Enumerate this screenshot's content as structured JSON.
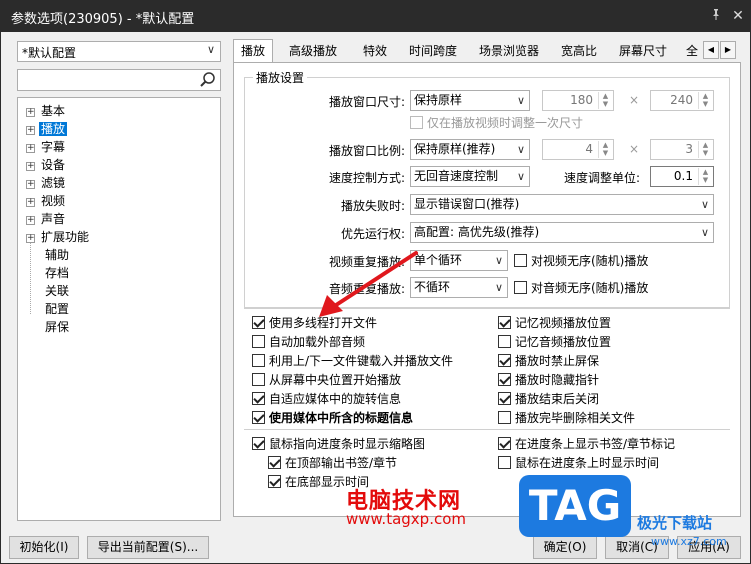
{
  "window": {
    "title": "参数选项(230905) - *默认配置"
  },
  "sidebar": {
    "profile": "*默认配置",
    "search_placeholder": "",
    "tree": [
      {
        "label": "基本",
        "expandable": true
      },
      {
        "label": "播放",
        "expandable": true,
        "selected": true
      },
      {
        "label": "字幕",
        "expandable": true
      },
      {
        "label": "设备",
        "expandable": true
      },
      {
        "label": "滤镜",
        "expandable": true
      },
      {
        "label": "视频",
        "expandable": true
      },
      {
        "label": "声音",
        "expandable": true
      },
      {
        "label": "扩展功能",
        "expandable": true
      },
      {
        "label": "辅助",
        "expandable": false
      },
      {
        "label": "存档",
        "expandable": false
      },
      {
        "label": "关联",
        "expandable": false
      },
      {
        "label": "配置",
        "expandable": false
      },
      {
        "label": "屏保",
        "expandable": false
      }
    ]
  },
  "tabs": [
    "播放",
    "高级播放",
    "特效",
    "时间跨度",
    "场景浏览器",
    "宽高比",
    "屏幕尺寸",
    "全"
  ],
  "playback": {
    "group_title": "播放设置",
    "window_size_label": "播放窗口尺寸:",
    "window_size_value": "保持原样",
    "width_value": "180",
    "height_value": "240",
    "times_sign": "×",
    "only_once_label": "仅在播放视频时调整一次尺寸",
    "ratio_label": "播放窗口比例:",
    "ratio_value": "保持原样(推荐)",
    "ratio_w": "4",
    "ratio_h": "3",
    "speed_mode_label": "速度控制方式:",
    "speed_mode_value": "无回音速度控制",
    "speed_unit_label": "速度调整单位:",
    "speed_unit_value": "0.1",
    "fail_label": "播放失败时:",
    "fail_value": "显示错误窗口(推荐)",
    "priority_label": "优先运行权:",
    "priority_value": "高配置: 高优先级(推荐)",
    "video_repeat_label": "视频重复播放:",
    "video_repeat_value": "单个循环",
    "video_random_label": "对视频无序(随机)播放",
    "audio_repeat_label": "音频重复播放:",
    "audio_repeat_value": "不循环",
    "audio_random_label": "对音频无序(随机)播放"
  },
  "options_left": [
    {
      "label": "使用多线程打开文件",
      "checked": true
    },
    {
      "label": "自动加载外部音频",
      "checked": false
    },
    {
      "label": "利用上/下一文件键载入并播放文件",
      "checked": false
    },
    {
      "label": "从屏幕中央位置开始播放",
      "checked": false
    },
    {
      "label": "自适应媒体中的旋转信息",
      "checked": true
    },
    {
      "label": "使用媒体中所含的标题信息",
      "checked": true
    }
  ],
  "options_right": [
    {
      "label": "记忆视频播放位置",
      "checked": true
    },
    {
      "label": "记忆音频播放位置",
      "checked": false
    },
    {
      "label": "播放时禁止屏保",
      "checked": true
    },
    {
      "label": "播放时隐藏指针",
      "checked": true
    },
    {
      "label": "播放结束后关闭",
      "checked": true
    },
    {
      "label": "播放完毕删除相关文件",
      "checked": false
    }
  ],
  "seekbar": {
    "thumbnail_label": "鼠标指向进度条时显示缩略图",
    "top_label": "在顶部输出书签/章节",
    "bottom_label": "在底部显示时间",
    "bookmark_label": "在进度条上显示书签/章节标记",
    "time_label": "鼠标在进度条上时显示时间"
  },
  "buttons": {
    "init": "初始化(I)",
    "export": "导出当前配置(S)...",
    "ok": "确定(O)",
    "cancel": "取消(C)",
    "apply": "应用(A)"
  },
  "watermark": {
    "site_name": "电脑技术网",
    "url": "www.tagxp.com",
    "logo": "TAG",
    "site2": "极光下载站",
    "site2_url": "www.xz7.com"
  },
  "colors": {
    "titlebar": "#2b2b2b",
    "selection": "#0078d7",
    "watermark_red": "#e30b0b",
    "watermark_blue": "#1d7ae0"
  }
}
